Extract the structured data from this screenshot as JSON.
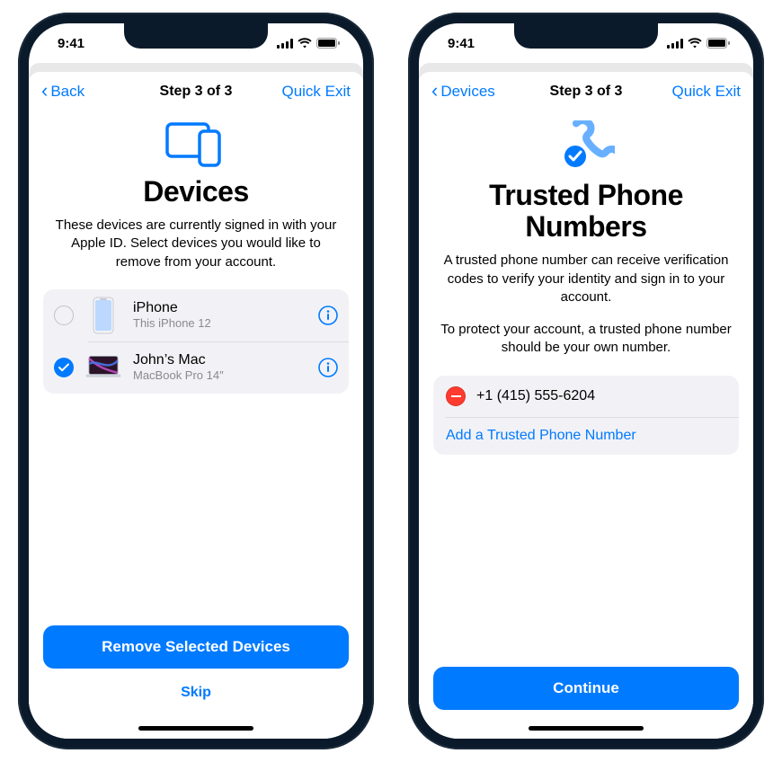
{
  "status": {
    "time": "9:41"
  },
  "left": {
    "nav": {
      "back": "Back",
      "step": "Step 3 of 3",
      "quick_exit": "Quick Exit"
    },
    "title": "Devices",
    "desc": "These devices are currently signed in with your Apple ID. Select devices you would like to remove from your account.",
    "devices": [
      {
        "name": "iPhone",
        "model": "This iPhone 12",
        "checked": false
      },
      {
        "name": "John’s Mac",
        "model": "MacBook Pro 14″",
        "checked": true
      }
    ],
    "primary": "Remove Selected Devices",
    "secondary": "Skip"
  },
  "right": {
    "nav": {
      "back": "Devices",
      "step": "Step 3 of 3",
      "quick_exit": "Quick Exit"
    },
    "title": "Trusted Phone Numbers",
    "desc1": "A trusted phone number can receive verification codes to verify your identity and sign in to your account.",
    "desc2": "To protect your account, a trusted phone number should be your own number.",
    "number": "+1 (415) 555-6204",
    "add": "Add a Trusted Phone Number",
    "primary": "Continue"
  }
}
